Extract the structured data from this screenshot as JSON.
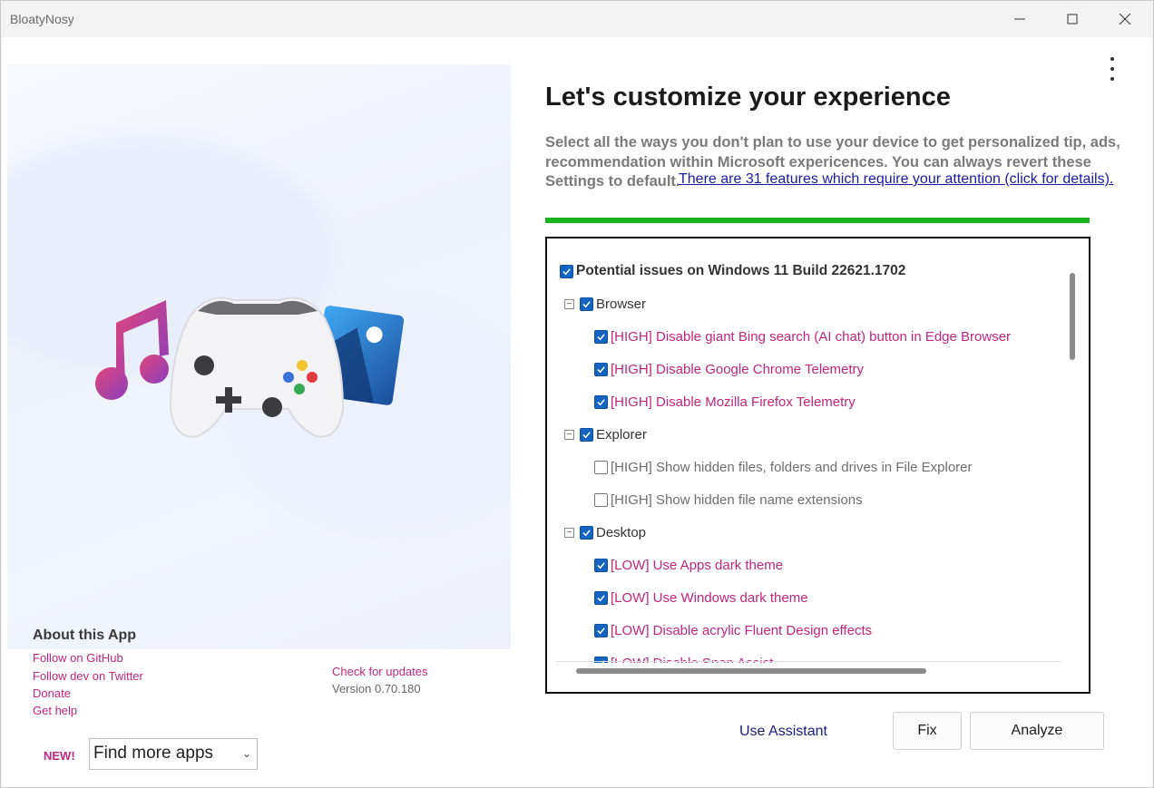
{
  "window": {
    "title": "BloatyNosy"
  },
  "about": {
    "title": "About this App",
    "links": [
      "Follow on GitHub",
      "Follow dev on Twitter",
      "Donate",
      "Get help"
    ],
    "check_updates": "Check for updates",
    "version": "Version 0.70.180"
  },
  "promo": {
    "new_label": "NEW!",
    "select_value": "Find more apps"
  },
  "main": {
    "heading": "Let's customize your experience",
    "description": "Select all the ways you don't plan to use your device to get personalized tip, ads, recommendation within Microsoft expericences. You can always revert these Settings to default.",
    "attention_link": "There are 31 features which require your attention (click for details).",
    "progress": 1.0,
    "progress_color": "#16b21f"
  },
  "tree": {
    "root": {
      "label": "Potential issues on Windows 11 Build 22621.1702",
      "checked": true
    },
    "categories": [
      {
        "label": "Browser",
        "checked": true,
        "expanded": true,
        "items": [
          {
            "label": "[HIGH] Disable giant Bing search (AI chat) button in Edge Browser",
            "checked": true
          },
          {
            "label": "[HIGH] Disable Google Chrome Telemetry",
            "checked": true
          },
          {
            "label": "[HIGH] Disable Mozilla Firefox Telemetry",
            "checked": true
          }
        ]
      },
      {
        "label": "Explorer",
        "checked": true,
        "expanded": true,
        "items": [
          {
            "label": "[HIGH] Show hidden files, folders and drives in File Explorer",
            "checked": false
          },
          {
            "label": "[HIGH] Show hidden file name extensions",
            "checked": false
          }
        ]
      },
      {
        "label": "Desktop",
        "checked": true,
        "expanded": true,
        "items": [
          {
            "label": "[LOW] Use Apps dark theme",
            "checked": true
          },
          {
            "label": "[LOW] Use Windows dark theme",
            "checked": true
          },
          {
            "label": "[LOW] Disable acrylic Fluent Design effects",
            "checked": true
          },
          {
            "label": "[LOW] Disable Snap Assist",
            "checked": true
          }
        ]
      }
    ]
  },
  "actions": {
    "use_assistant": "Use Assistant",
    "fix": "Fix",
    "analyze": "Analyze"
  },
  "colors": {
    "accent_checkbox": "#1565c0",
    "high_item_text": "#c0267d",
    "link": "#c0267d"
  }
}
